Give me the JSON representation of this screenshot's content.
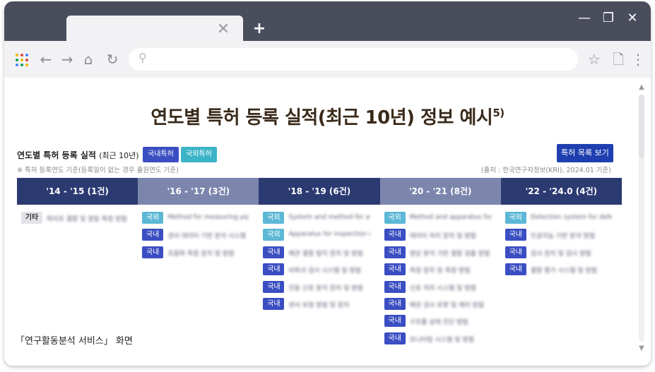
{
  "browser": {
    "tab_close": "✕",
    "new_tab": "+",
    "window_controls": [
      "—",
      "❐",
      "✕"
    ],
    "url_placeholder": "",
    "colors": {
      "frame": "#4a4e5c",
      "toolbar": "#f2f2f4"
    }
  },
  "page": {
    "title": "연도별 특허 등록 실적(최근 10년) 정보 예시",
    "title_sup": "5)",
    "caption": "「연구활동분석 서비스」 화면"
  },
  "panel": {
    "title": "연도별 특허 등록 실적",
    "title_note": "(최근 10년)",
    "tag_domestic": "국내특허",
    "tag_foreign": "국외특허",
    "list_button": "특허 목록 보기",
    "note": "※ 특허 등록연도 기준(등록일이 없는 경우 출원연도 기준)",
    "source": "(출처 : 한국연구자정보(KRI), 2024.01 기준)"
  },
  "timeline": [
    {
      "label": "'14 - '15 (1건)",
      "style": "dark"
    },
    {
      "label": "'16 - '17 (3건)",
      "style": "light"
    },
    {
      "label": "'18 - '19 (6건)",
      "style": "dark"
    },
    {
      "label": "'20 - '21 (8건)",
      "style": "light"
    },
    {
      "label": "'22 - '24.0 (4건)",
      "style": "dark"
    }
  ],
  "columns": [
    [
      {
        "badge": "기타",
        "type": "etc",
        "text": "파이프 결함 및 정밀 측정 방법"
      }
    ],
    [
      {
        "badge": "국외",
        "type": "foreign",
        "text": "Method for measuring pipe defects"
      },
      {
        "badge": "국내",
        "type": "domestic",
        "text": "센서 데이터 기반 분석 시스템"
      },
      {
        "badge": "국내",
        "type": "domestic",
        "text": "초음파 측정 장치 및 방법"
      }
    ],
    [
      {
        "badge": "국외",
        "type": "foreign",
        "text": "System and method for analysis"
      },
      {
        "badge": "국외",
        "type": "foreign",
        "text": "Apparatus for inspection of pipe"
      },
      {
        "badge": "국내",
        "type": "domestic",
        "text": "배관 결함 탐지 장치 및 방법"
      },
      {
        "badge": "국내",
        "type": "domestic",
        "text": "비파괴 검사 시스템 및 방법"
      },
      {
        "badge": "국내",
        "type": "domestic",
        "text": "진동 신호 분석 장치 및 방법"
      },
      {
        "badge": "국내",
        "type": "domestic",
        "text": "센서 보정 방법 및 장치"
      }
    ],
    [
      {
        "badge": "국외",
        "type": "foreign",
        "text": "Method and apparatus for sensor"
      },
      {
        "badge": "국내",
        "type": "domestic",
        "text": "데이터 처리 장치 및 방법"
      },
      {
        "badge": "국내",
        "type": "domestic",
        "text": "영상 분석 기반 결함 검출 방법"
      },
      {
        "badge": "국내",
        "type": "domestic",
        "text": "측정 장치 및 측정 방법"
      },
      {
        "badge": "국내",
        "type": "domestic",
        "text": "신호 처리 시스템 및 방법"
      },
      {
        "badge": "국내",
        "type": "domestic",
        "text": "배관 검사 로봇 및 제어 방법"
      },
      {
        "badge": "국내",
        "type": "domestic",
        "text": "구조물 상태 진단 방법"
      },
      {
        "badge": "국내",
        "type": "domestic",
        "text": "모니터링 시스템 및 방법"
      }
    ],
    [
      {
        "badge": "국외",
        "type": "foreign",
        "text": "Detection system for defects"
      },
      {
        "badge": "국내",
        "type": "domestic",
        "text": "인공지능 기반 분석 방법"
      },
      {
        "badge": "국내",
        "type": "domestic",
        "text": "검사 장치 및 검사 방법"
      },
      {
        "badge": "국내",
        "type": "domestic",
        "text": "결함 평가 시스템 및 방법"
      }
    ]
  ]
}
